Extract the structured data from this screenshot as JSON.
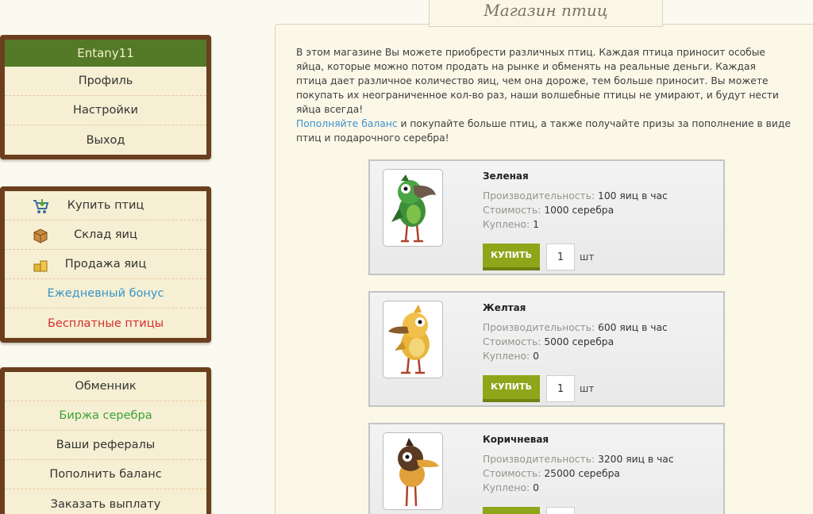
{
  "user_menu": {
    "username": "Entany11",
    "items": [
      {
        "label": "Профиль"
      },
      {
        "label": "Настройки"
      },
      {
        "label": "Выход"
      }
    ]
  },
  "shop_menu": {
    "items": [
      {
        "label": "Купить птиц",
        "icon": "cart-icon"
      },
      {
        "label": "Склад яиц",
        "icon": "box-icon"
      },
      {
        "label": "Продажа яиц",
        "icon": "coins-icon"
      },
      {
        "label": "Ежедневный бонус",
        "color": "#3794c8"
      },
      {
        "label": "Бесплатные птицы",
        "color": "#d42e2e"
      }
    ]
  },
  "finance_menu": {
    "items": [
      {
        "label": "Обменник"
      },
      {
        "label": "Биржа серебра",
        "color": "#3ca33c"
      },
      {
        "label": "Ваши рефералы"
      },
      {
        "label": "Пополнить баланс"
      },
      {
        "label": "Заказать выплату"
      }
    ]
  },
  "page": {
    "title": "Магазин птиц",
    "intro": "В этом магазине Вы можете приобрести различных птиц. Каждая птица приносит особые яйца, которые можно потом продать на рынке и обменять на реальные деньги. Каждая птица дает различное количество яиц, чем она дороже, тем больше приносит. Вы можете покупать их неограниченное кол-во раз, наши волшебные птицы не умирают, и будут нести яйца всегда!",
    "topup_link": "Пополняйте баланс",
    "topup_text": " и покупайте больше птиц, а также получайте призы за пополнение в виде птиц и подарочного серебра!"
  },
  "labels": {
    "productivity": "Производительность:",
    "cost": "Стоимость:",
    "bought": "Куплено:",
    "buy_button": "КУПИТЬ",
    "unit": "шт"
  },
  "birds": [
    {
      "name": "Зеленая",
      "productivity": "100 яиц в час",
      "cost": "1000 серебра",
      "bought": "1",
      "qty": "1",
      "color": "#3e8f3a"
    },
    {
      "name": "Желтая",
      "productivity": "600 яиц в час",
      "cost": "5000 серебра",
      "bought": "0",
      "qty": "1",
      "color": "#e8b53a"
    },
    {
      "name": "Коричневая",
      "productivity": "3200 яиц в час",
      "cost": "25000 серебра",
      "bought": "0",
      "qty": "",
      "color": "#5a3a22"
    }
  ],
  "colors": {
    "accent_green": "#547a28",
    "buy_button": "#8fa61a",
    "link_blue": "#3f8fce",
    "menu_frame": "#6b3f1e"
  }
}
